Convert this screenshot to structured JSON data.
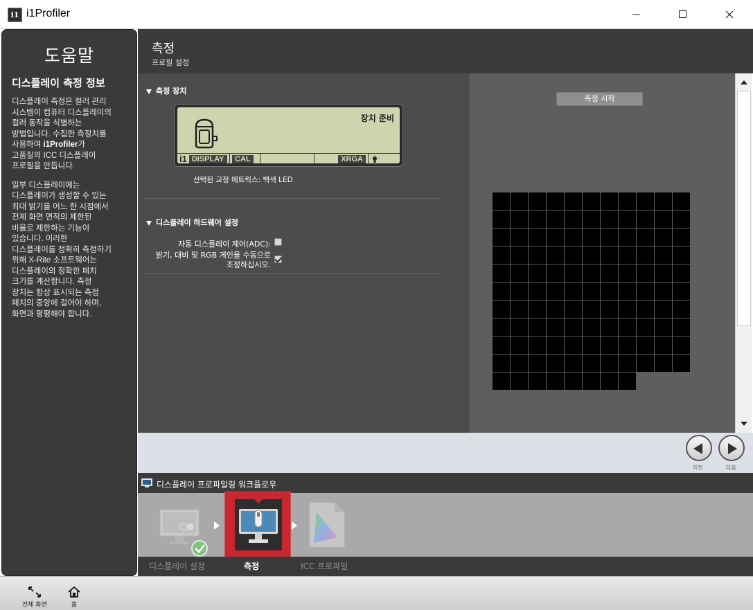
{
  "window": {
    "title": "i1Profiler",
    "icon_glyph": "i1"
  },
  "help": {
    "title": "도움말",
    "subtitle": "디스플레이 측정 정보",
    "para1": [
      "디스플레이 측정은 컬러 관리",
      "시스템이 컴퓨터 디스플레이의",
      "컬러 동작을 식별하는",
      "방법입니다. 수집한 측정치를",
      "사용하여 ",
      "i1Profiler",
      "가",
      "고품질의 ICC 디스플레이",
      "프로필을 만듭니다."
    ],
    "para2": [
      "일부 디스플레이에는",
      "디스플레이가 생성할 수 있는",
      "최대 밝기를 어느 한 시점에서",
      "전체 화면 면적의 제한된",
      "비율로 제한하는 기능이",
      "있습니다. 이러한",
      "디스플레이를 정확히 측정하기",
      "위해 X-Rite 소프트웨어는",
      "디스플레이의 정확한 패치",
      "크기를 계산합니다. 측정",
      "장치는 항상 표시되는 측정",
      "패치의 중앙에 걸어야 하며,",
      "화면과 평평해야 합니다."
    ]
  },
  "header": {
    "title": "측정",
    "subtitle": "프로필 설정"
  },
  "settings": {
    "device_section": "측정 장치",
    "lcd": {
      "status": "장치 준비",
      "brand_i1": "i1",
      "brand_display": "DISPLAY",
      "cal": "CAL",
      "mode": "XRGA"
    },
    "matrix_caption": "선택된 교정 매트릭스:  백색 LED",
    "hardware_section": "디스플레이 하드웨어 설정",
    "adc_label": "자동 디스플레이 제어(ADC):",
    "adc_checked": false,
    "manual_label_line1": "밝기, 대비 및 RGB 게인을 수동으로",
    "manual_label_line2": "조정하십시오.",
    "manual_checked": true
  },
  "preview": {
    "start_button": "측정 시작",
    "patch_count": 118,
    "patch_color": "#000000"
  },
  "nav": {
    "prev_label": "이전",
    "next_label": "다음"
  },
  "workflow": {
    "title": "디스플레이 프로파일링 워크플로우",
    "steps": [
      {
        "label": "디스플레이 설정",
        "state": "done"
      },
      {
        "label": "측정",
        "state": "active"
      },
      {
        "label": "ICC 프로파일",
        "state": "pending"
      }
    ],
    "accent_color": "#c7272f"
  },
  "bottom": {
    "fullscreen_label": "전체 화면",
    "home_label": "홈"
  }
}
